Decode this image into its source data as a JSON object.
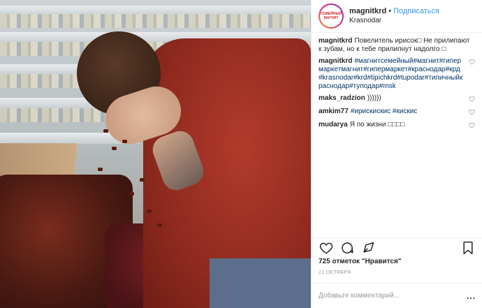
{
  "header": {
    "avatar_text": "СЕМЕЙНЫЙ МАГНИТ",
    "username": "magnitkrd",
    "separator": "•",
    "follow_label": "Подписаться",
    "location": "Krasnodar"
  },
  "comments": [
    {
      "user": "magnitkrd",
      "text": "Повелитель ирисок□ Не прилипают к зубам, но к тебе прилипнут надолго □",
      "tags": "",
      "heart": false
    },
    {
      "user": "magnitkrd",
      "text": "",
      "tags": "#магнитсемейный#магнит#гипермаркетмагнит#гипермаркет#краснодар#крд#krasnodar#krd#tipichkrd#tupodar#типичныйкраснодар#туподар#msk",
      "heart": true
    },
    {
      "user": "maks_radzion",
      "text": "))))))",
      "tags": "",
      "heart": true
    },
    {
      "user": "amkim77",
      "text": "",
      "tags": "#ирискискис #кискис",
      "heart": true
    },
    {
      "user": "mudarya",
      "text": "Я по жизни □□□□",
      "tags": "",
      "heart": true
    }
  ],
  "actions": {
    "like_icon": "heart-icon",
    "comment_icon": "comment-icon",
    "share_icon": "share-icon",
    "save_icon": "bookmark-icon"
  },
  "likes": "725 отметок \"Нравится\"",
  "date": "21 ОКТЯБРЯ",
  "add_comment": {
    "placeholder": "Добавьте комментарий...",
    "more": "..."
  },
  "colors": {
    "link": "#3897f0",
    "hashtag": "#003569",
    "text": "#262626",
    "muted": "#999999",
    "border": "#efefef"
  }
}
